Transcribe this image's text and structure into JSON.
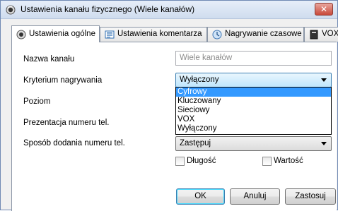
{
  "window": {
    "title": "Ustawienia kanału fizycznego (Wiele kanałów)",
    "close_glyph": "✕",
    "icon": "gear-icon"
  },
  "tabs": [
    {
      "label": "Ustawienia ogólne",
      "icon": "gear-icon",
      "active": true
    },
    {
      "label": "Ustawienia komentarza",
      "icon": "comment-icon",
      "active": false
    },
    {
      "label": "Nagrywanie czasowe",
      "icon": "clock-icon",
      "active": false
    },
    {
      "label": "VOX",
      "icon": "vox-icon",
      "active": false
    }
  ],
  "form": {
    "channel_name": {
      "label": "Nazwa kanału",
      "value": "",
      "placeholder": "Wiele kanałów"
    },
    "recording_criterion": {
      "label": "Kryterium nagrywania",
      "value": "Wyłączony",
      "options": [
        "Cyfrowy",
        "Kluczowany",
        "Sieciowy",
        "VOX",
        "Wyłączony"
      ],
      "highlighted": "Cyfrowy"
    },
    "level": {
      "label": "Poziom"
    },
    "number_presentation": {
      "label": "Prezentacja numeru tel."
    },
    "number_add_method": {
      "label": "Sposób dodania numeru tel.",
      "value": "Zastępuj"
    },
    "length_checkbox": {
      "label": "Długość",
      "checked": false
    },
    "value_checkbox": {
      "label": "Wartość",
      "checked": false
    }
  },
  "buttons": {
    "ok": "OK",
    "cancel": "Anuluj",
    "apply": "Zastosuj"
  },
  "colors": {
    "selection": "#3399ff",
    "close_button": "#c8493b",
    "titlebar": "#cfdcee"
  }
}
